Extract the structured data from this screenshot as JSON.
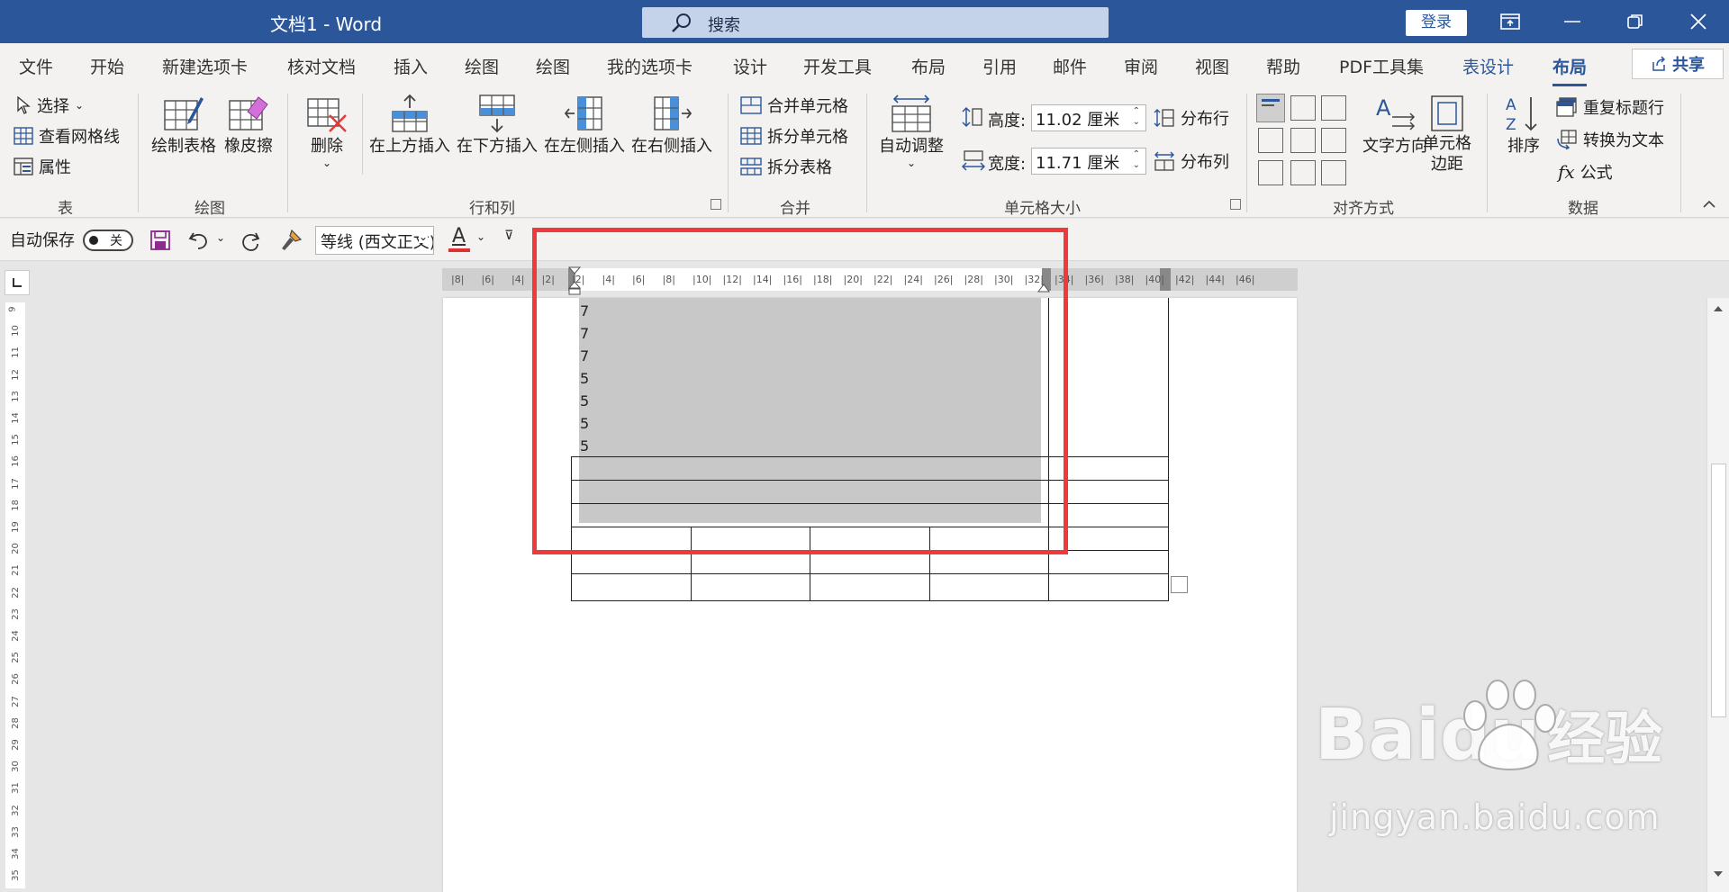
{
  "titlebar": {
    "title": "文档1  -  Word",
    "search_placeholder": "搜索",
    "login": "登录"
  },
  "tabs": [
    "文件",
    "开始",
    "新建选项卡",
    "核对文档",
    "插入",
    "绘图",
    "绘图",
    "我的选项卡",
    "设计",
    "开发工具",
    "布局",
    "引用",
    "邮件",
    "审阅",
    "视图",
    "帮助",
    "PDF工具集",
    "表设计",
    "布局"
  ],
  "share": "共享",
  "ribbon": {
    "table": {
      "select": "选择",
      "gridlines": "查看网格线",
      "properties": "属性",
      "group": "表"
    },
    "draw": {
      "draw_table": "绘制表格",
      "eraser": "橡皮擦",
      "group": "绘图"
    },
    "rows_cols": {
      "delete": "删除",
      "insert_above": "在上方插入",
      "insert_below": "在下方插入",
      "insert_left": "在左侧插入",
      "insert_right": "在右侧插入",
      "group": "行和列"
    },
    "merge": {
      "merge_cells": "合并单元格",
      "split_cells": "拆分单元格",
      "split_table": "拆分表格",
      "group": "合并"
    },
    "cell_size": {
      "autofit": "自动调整",
      "height_label": "高度:",
      "height_value": "11.02 厘米",
      "width_label": "宽度:",
      "width_value": "11.71 厘米",
      "dist_rows": "分布行",
      "dist_cols": "分布列",
      "group": "单元格大小"
    },
    "align": {
      "text_direction": "文字方向",
      "cell_margins_1": "单元格",
      "cell_margins_2": "边距",
      "group": "对齐方式"
    },
    "data": {
      "sort": "排序",
      "repeat_header": "重复标题行",
      "convert_text": "转换为文本",
      "formula": "公式",
      "group": "数据"
    }
  },
  "qat": {
    "autosave": "自动保存",
    "toggle": "关",
    "font": "等线 (西文正文)"
  },
  "hruler_labels": [
    "8",
    "6",
    "4",
    "2",
    "2",
    "4",
    "6",
    "8",
    "10",
    "12",
    "14",
    "16",
    "18",
    "20",
    "22",
    "24",
    "26",
    "28",
    "30",
    "32",
    "34",
    "36",
    "38",
    "40",
    "42",
    "44",
    "46"
  ],
  "vruler_labels": [
    "9",
    "10",
    "11",
    "12",
    "13",
    "14",
    "15",
    "16",
    "17",
    "18",
    "19",
    "20",
    "21",
    "22",
    "23",
    "24",
    "25",
    "26",
    "27",
    "28",
    "29",
    "30",
    "31",
    "32",
    "33",
    "34",
    "35"
  ],
  "cells": [
    "7",
    "7",
    "7",
    "5",
    "5",
    "5",
    "5"
  ],
  "watermark": {
    "brand": "Baidu",
    "brand_cn": "经验",
    "url": "jingyan.baidu.com"
  }
}
